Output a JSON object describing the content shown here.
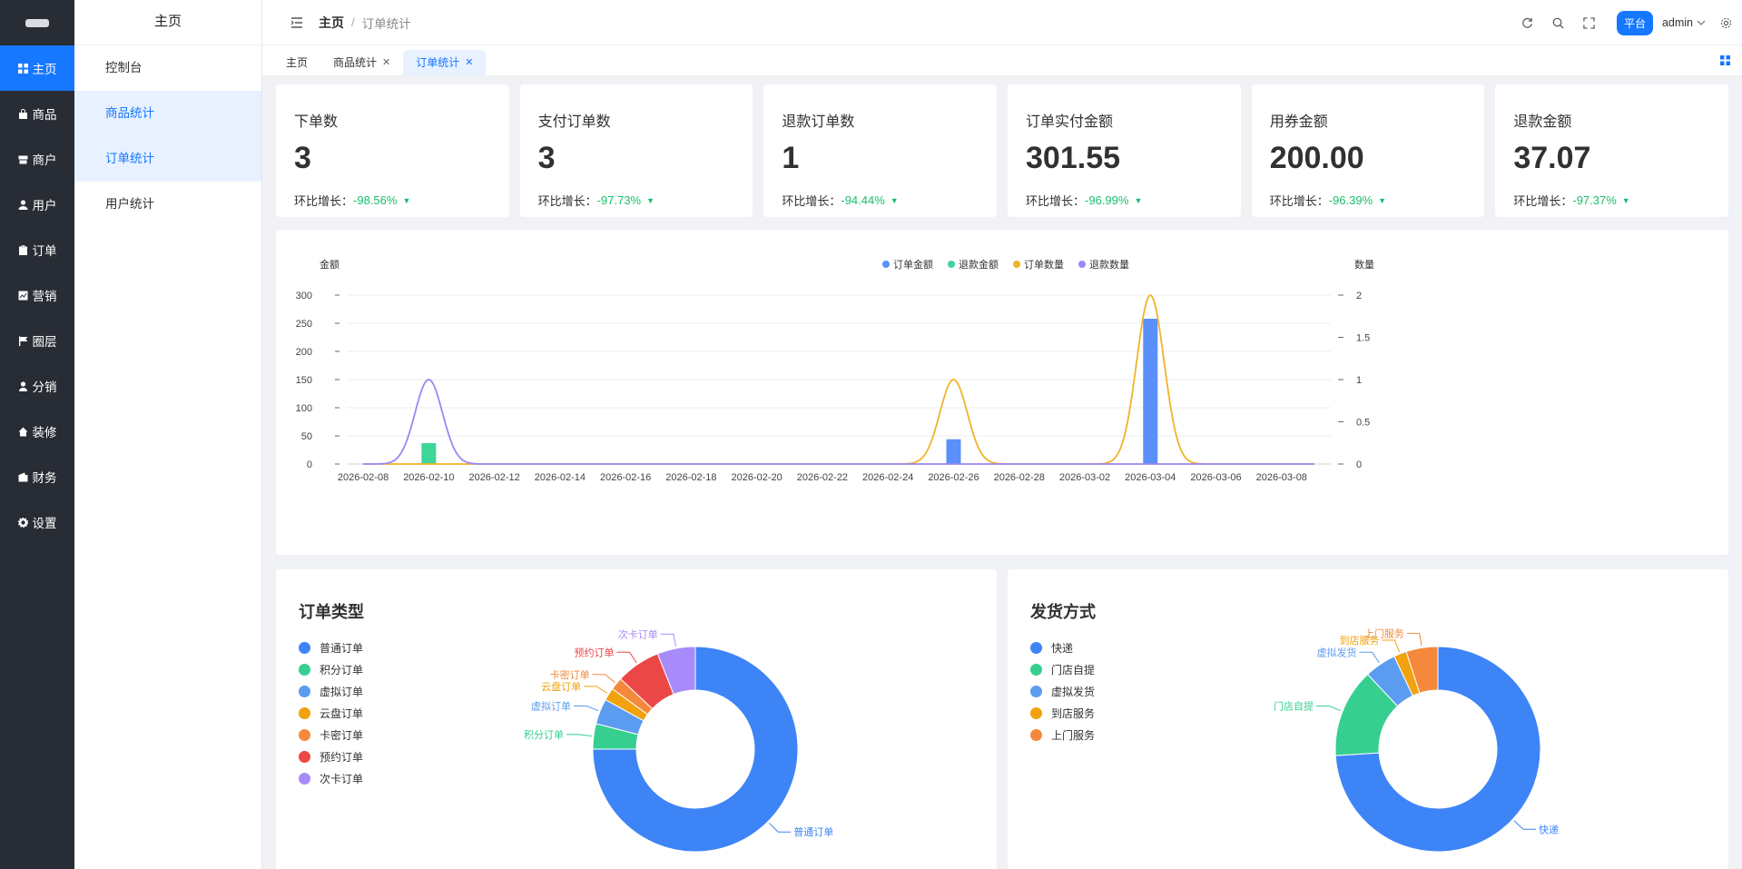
{
  "nav": {
    "items": [
      {
        "label": "主页",
        "icon": "grid-icon"
      },
      {
        "label": "商品",
        "icon": "bag-icon"
      },
      {
        "label": "商户",
        "icon": "shop-icon"
      },
      {
        "label": "用户",
        "icon": "user-icon"
      },
      {
        "label": "订单",
        "icon": "clipboard-icon"
      },
      {
        "label": "营销",
        "icon": "chart-icon"
      },
      {
        "label": "圈层",
        "icon": "flag-icon"
      },
      {
        "label": "分销",
        "icon": "person-icon"
      },
      {
        "label": "装修",
        "icon": "home-icon"
      },
      {
        "label": "财务",
        "icon": "wallet-icon"
      },
      {
        "label": "设置",
        "icon": "gear-icon"
      }
    ]
  },
  "submenu": {
    "title": "主页",
    "items": [
      "控制台",
      "商品统计",
      "订单统计",
      "用户统计"
    ]
  },
  "header": {
    "breadcrumb_root": "主页",
    "breadcrumb_sep": "/",
    "breadcrumb_current": "订单统计",
    "platform_button": "平台",
    "user": "admin"
  },
  "tabs": [
    {
      "label": "主页",
      "closable": false
    },
    {
      "label": "商品统计",
      "closable": true
    },
    {
      "label": "订单统计",
      "closable": true
    }
  ],
  "tab_close_glyph": "✕",
  "ring_label": "环比增长：",
  "stats": [
    {
      "title": "下单数",
      "value": "3",
      "growth": "-98.56%"
    },
    {
      "title": "支付订单数",
      "value": "3",
      "growth": "-97.73%"
    },
    {
      "title": "退款订单数",
      "value": "1",
      "growth": "-94.44%"
    },
    {
      "title": "订单实付金额",
      "value": "301.55",
      "growth": "-96.99%"
    },
    {
      "title": "用券金额",
      "value": "200.00",
      "growth": "-96.39%"
    },
    {
      "title": "退款金额",
      "value": "37.07",
      "growth": "-97.37%"
    }
  ],
  "colors": {
    "accent": "#1677ff",
    "down": "#19be6b",
    "order_amount": "#5b8ff9",
    "refund_amount": "#3dd598",
    "order_count": "#f0b429",
    "refund_count": "#9b87f5"
  },
  "chart_data": [
    {
      "type": "bar+line",
      "ylabel": "金额",
      "y2label": "数量",
      "ylim": [
        0,
        300
      ],
      "y2lim": [
        0,
        2
      ],
      "yticks": [
        0,
        50,
        100,
        150,
        200,
        250,
        300
      ],
      "y2ticks": [
        "0",
        "0.5",
        "1",
        "1.5",
        "2"
      ],
      "legend_position": "top-center",
      "x_tick_labels": [
        "2026-02-08",
        "2026-02-10",
        "2026-02-12",
        "2026-02-14",
        "2026-02-16",
        "2026-02-18",
        "2026-02-20",
        "2026-02-22",
        "2026-02-24",
        "2026-02-26",
        "2026-02-28",
        "2026-03-02",
        "2026-03-04",
        "2026-03-06",
        "2026-03-08"
      ],
      "series": [
        {
          "name": "订单金额",
          "kind": "bar",
          "axis": "left",
          "points": [
            [
              "2026-02-26",
              44
            ],
            [
              "2026-03-04",
              258
            ]
          ]
        },
        {
          "name": "退款金额",
          "kind": "bar",
          "axis": "left",
          "points": [
            [
              "2026-02-10",
              37.07
            ]
          ]
        },
        {
          "name": "订单数量",
          "kind": "line",
          "axis": "right",
          "points": [
            [
              "2026-02-26",
              1
            ],
            [
              "2026-03-04",
              2
            ]
          ]
        },
        {
          "name": "退款数量",
          "kind": "line",
          "axis": "right",
          "points": [
            [
              "2026-02-10",
              1
            ]
          ]
        }
      ]
    },
    {
      "type": "pie",
      "title": "订单类型",
      "slices": [
        {
          "name": "普通订单",
          "value": 75,
          "color": "#3d84f6"
        },
        {
          "name": "积分订单",
          "value": 4,
          "color": "#36cf8f"
        },
        {
          "name": "虚拟订单",
          "value": 4,
          "color": "#5b9cf0"
        },
        {
          "name": "云盘订单",
          "value": 2,
          "color": "#f1a20e"
        },
        {
          "name": "卡密订单",
          "value": 2,
          "color": "#f5893b"
        },
        {
          "name": "预约订单",
          "value": 7,
          "color": "#ec4747"
        },
        {
          "name": "次卡订单",
          "value": 6,
          "color": "#a78bfa"
        }
      ]
    },
    {
      "type": "pie",
      "title": "发货方式",
      "slices": [
        {
          "name": "快递",
          "value": 74,
          "color": "#3d84f6"
        },
        {
          "name": "门店自提",
          "value": 14,
          "color": "#36cf8f"
        },
        {
          "name": "虚拟发货",
          "value": 5,
          "color": "#5b9cf0"
        },
        {
          "name": "到店服务",
          "value": 2,
          "color": "#f1a20e"
        },
        {
          "name": "上门服务",
          "value": 5,
          "color": "#f5893b"
        }
      ]
    }
  ]
}
